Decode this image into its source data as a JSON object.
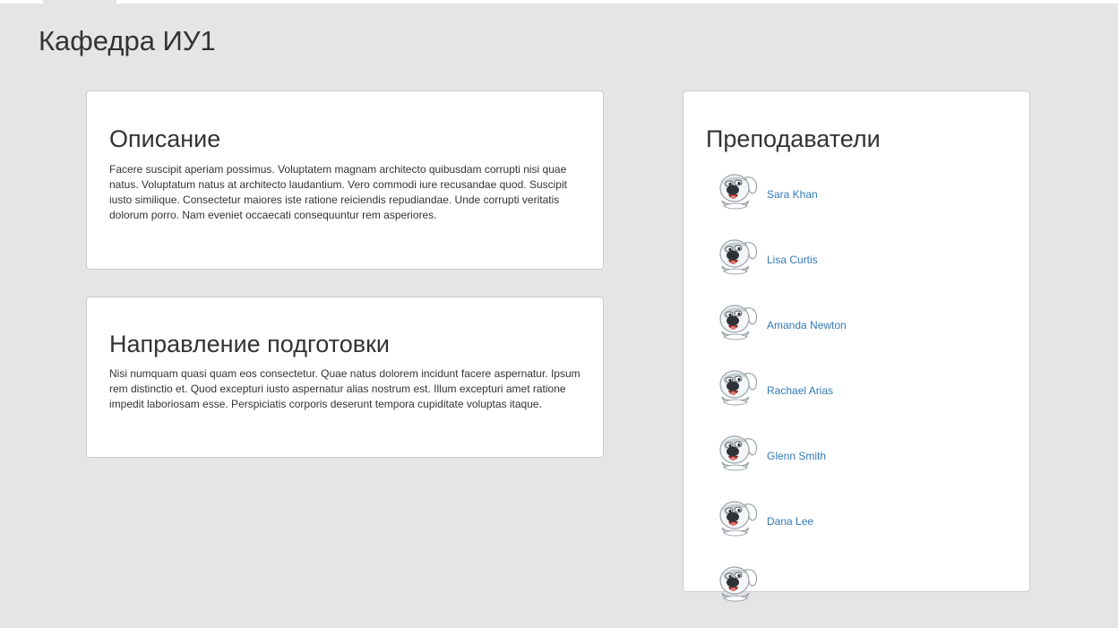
{
  "page": {
    "title": "Кафедра ИУ1"
  },
  "description": {
    "heading": "Описание",
    "text": "Facere suscipit aperiam possimus. Voluptatem magnam architecto quibusdam corrupti nisi quae natus. Voluptatum natus at architecto laudantium. Vero commodi iure recusandae quod. Suscipit iusto similique. Consectetur maiores iste ratione reiciendis repudiandae. Unde corrupti veritatis dolorum porro. Nam eveniet occaecati consequuntur rem asperiores."
  },
  "direction": {
    "heading": "Направление подготовки",
    "text": "Nisi numquam quasi quam eos consectetur. Quae natus dolorem incidunt facere aspernatur. Ipsum rem distinctio et. Quod excepturi iusto aspernatur alias nostrum est. Illum excepturi amet ratione impedit laboriosam esse. Perspiciatis corporis deserunt tempora cupiditate voluptas itaque."
  },
  "teachers": {
    "heading": "Преподаватели",
    "avatar_icon": "cartoon-dog-avatar-icon",
    "link_color": "#337ab7",
    "items": [
      {
        "name": "Sara Khan"
      },
      {
        "name": "Lisa Curtis"
      },
      {
        "name": "Amanda Newton"
      },
      {
        "name": "Rachael Arias"
      },
      {
        "name": "Glenn Smith"
      },
      {
        "name": "Dana Lee"
      },
      {
        "name": ""
      }
    ]
  }
}
